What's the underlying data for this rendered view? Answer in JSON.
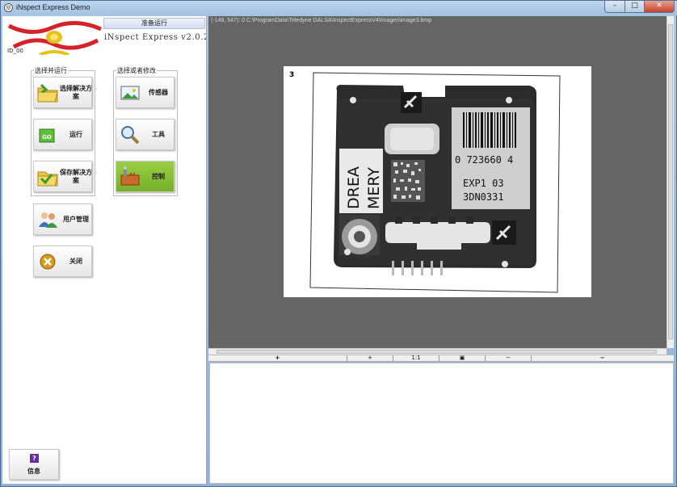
{
  "window": {
    "title": "iNspect Express Demo",
    "min": "–",
    "max": "□",
    "close": "✕"
  },
  "header": {
    "status": "准备运行",
    "version": "iNspect Express v2.0.2.0",
    "id": "ID_00",
    "logo_icon": "teledyne-dalsa-logo"
  },
  "groups": {
    "run": {
      "label": "选择并运行",
      "buttons": [
        {
          "label": "选择解决方案",
          "icon": "folder-icon"
        },
        {
          "label": "运行",
          "icon": "go-icon"
        },
        {
          "label": "保存解决方案",
          "icon": "folder-save-icon"
        }
      ]
    },
    "edit": {
      "label": "选择或者修改",
      "buttons": [
        {
          "label": "传感器",
          "icon": "image-icon"
        },
        {
          "label": "工具",
          "icon": "magnifier-icon"
        },
        {
          "label": "控制",
          "icon": "factory-icon"
        }
      ]
    }
  },
  "standalone": {
    "users": {
      "label": "用户管理",
      "icon": "users-icon"
    },
    "close": {
      "label": "关闭",
      "icon": "close-circle-icon"
    },
    "info": {
      "label": "信息",
      "icon": "help-icon",
      "glyph": "?"
    }
  },
  "viewer": {
    "coords": "(-148, 547): 0   C:\\ProgramData\\Teledyne DALSA\\InspectExpressV4\\Images\\image3.bmp",
    "frame_number": "3",
    "barcode_number": "0  723660  4",
    "label_line1": "EXP1 03",
    "label_line2": "3DN0331",
    "sticker_line1": "DREA",
    "sticker_line2": "MERY"
  },
  "toolbar": {
    "zoom_in": "+",
    "zoom_in_small": "+",
    "fit": "1:1",
    "fit_window": "▣",
    "zoom_out_small": "−",
    "zoom_out": "−"
  },
  "colors": {
    "active_button": "#8bc03a",
    "viewer_bg": "#656565"
  }
}
